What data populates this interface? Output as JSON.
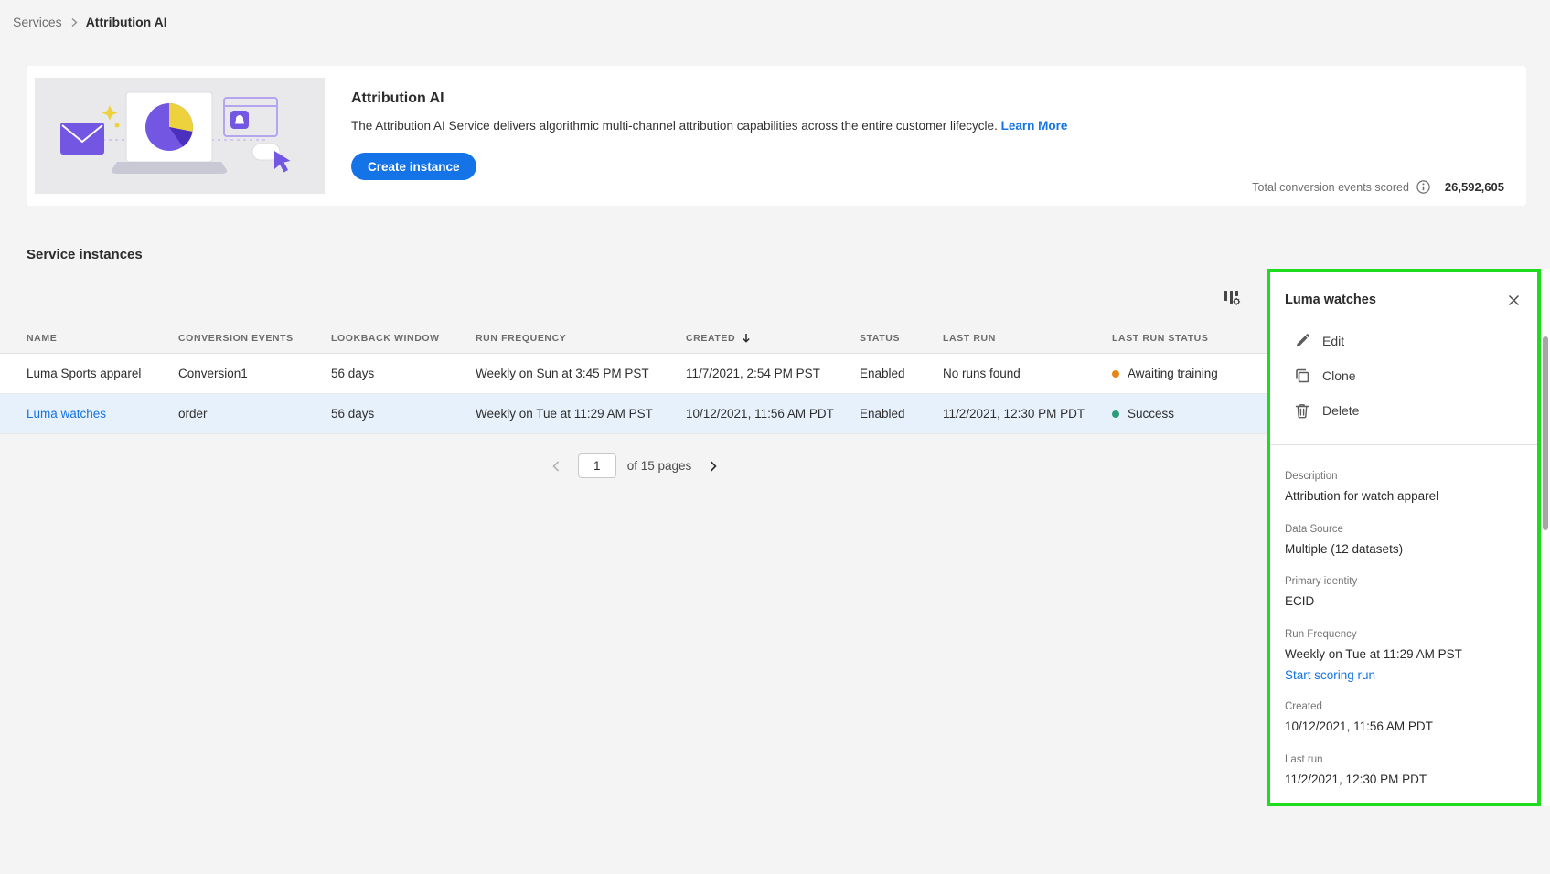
{
  "breadcrumb": {
    "root": "Services",
    "current": "Attribution AI"
  },
  "hero": {
    "title": "Attribution AI",
    "description": "The Attribution AI Service delivers algorithmic multi-channel attribution capabilities across the entire customer lifecycle.",
    "learn_more": "Learn More",
    "create_button": "Create instance",
    "total_label": "Total conversion events scored",
    "total_value": "26,592,605"
  },
  "instances": {
    "heading": "Service instances",
    "columns": [
      "NAME",
      "CONVERSION EVENTS",
      "LOOKBACK WINDOW",
      "RUN FREQUENCY",
      "CREATED",
      "STATUS",
      "LAST RUN",
      "LAST RUN STATUS"
    ],
    "rows": [
      {
        "name": "Luma Sports apparel",
        "conversion_events": "Conversion1",
        "lookback_window": "56 days",
        "run_frequency": "Weekly on Sun at 3:45 PM PST",
        "created": "11/7/2021, 2:54 PM PST",
        "status": "Enabled",
        "last_run": "No runs found",
        "last_run_status": "Awaiting training"
      },
      {
        "name": "Luma watches",
        "conversion_events": "order",
        "lookback_window": "56 days",
        "run_frequency": "Weekly on Tue at 11:29 AM PST",
        "created": "10/12/2021, 11:56 AM PDT",
        "status": "Enabled",
        "last_run": "11/2/2021, 12:30 PM PDT",
        "last_run_status": "Success"
      }
    ],
    "pagination": {
      "page": "1",
      "pages_label": "of 15 pages"
    }
  },
  "panel": {
    "title": "Luma watches",
    "actions": {
      "edit": "Edit",
      "clone": "Clone",
      "delete": "Delete"
    },
    "description_label": "Description",
    "description": "Attribution for watch apparel",
    "data_source_label": "Data Source",
    "data_source": "Multiple (12 datasets)",
    "primary_identity_label": "Primary identity",
    "primary_identity": "ECID",
    "run_frequency_label": "Run Frequency",
    "run_frequency": "Weekly on Tue at 11:29 AM PST",
    "start_scoring": "Start scoring run",
    "created_label": "Created",
    "created": "10/12/2021, 11:56 AM PDT",
    "last_run_label": "Last run",
    "last_run": "11/2/2021, 12:30 PM PDT"
  },
  "colors": {
    "accent": "#1473e6",
    "success": "#2d9d78",
    "warning": "#e68619",
    "selected_row": "#e7f1fc",
    "highlight_border": "#1ddc1d"
  }
}
